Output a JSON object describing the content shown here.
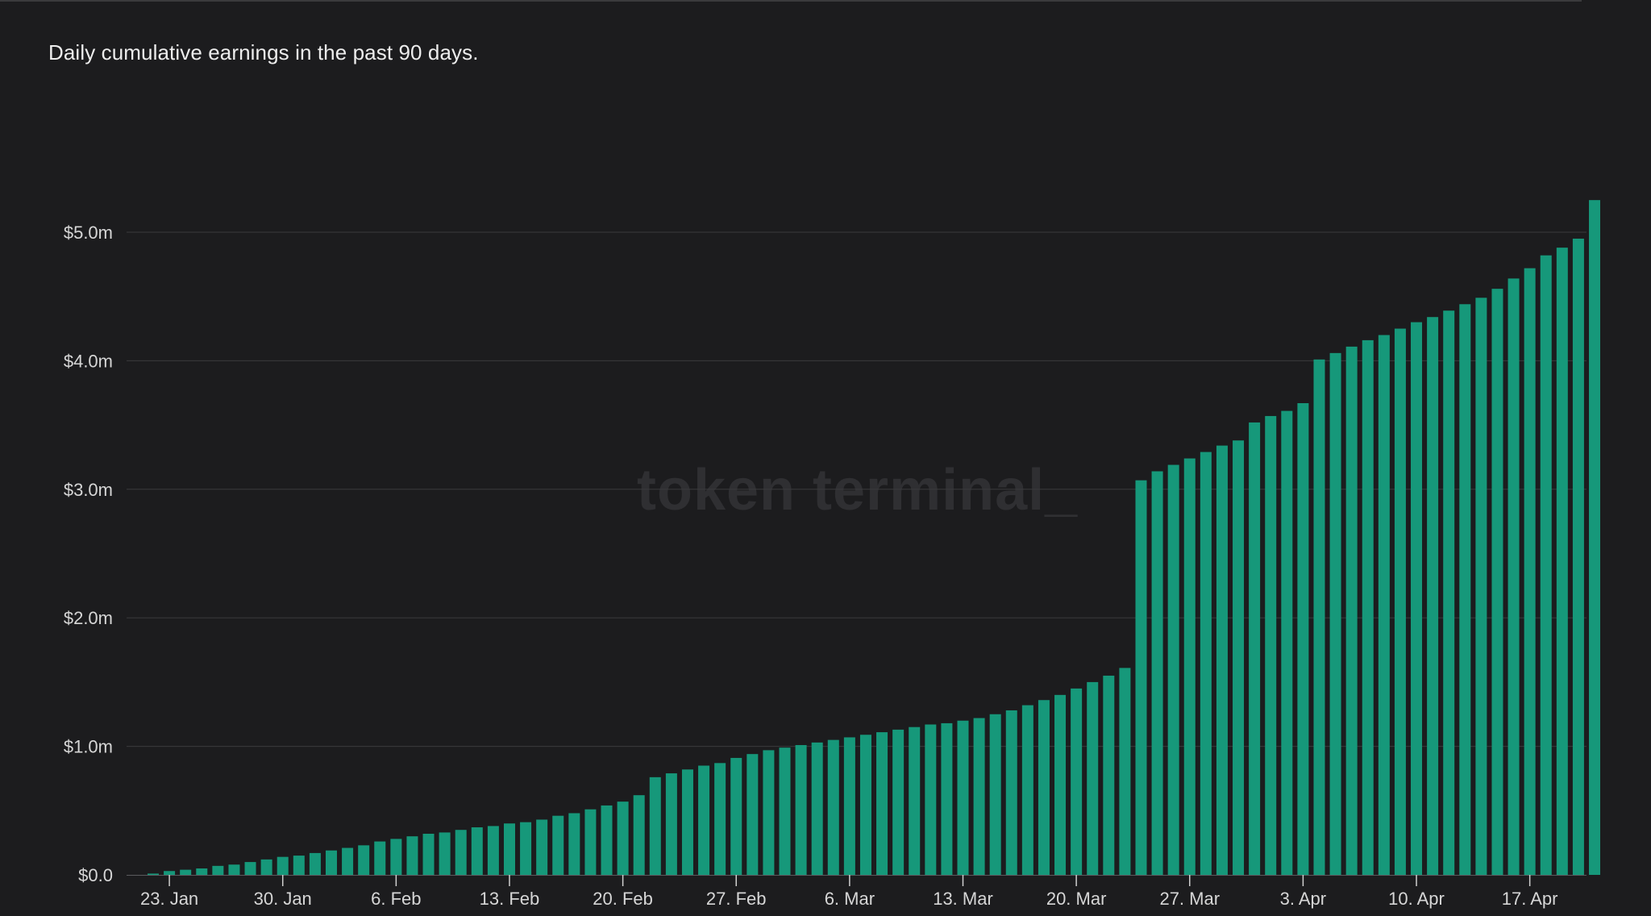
{
  "subtitle": "Daily cumulative earnings in the past 90 days.",
  "watermark": "token terminal_",
  "colors": {
    "bar": "#16987a",
    "background": "#1c1c1e",
    "grid": "#3a3a3c",
    "text": "#d6d6d6"
  },
  "chart_data": {
    "type": "bar",
    "title": "",
    "xlabel": "",
    "ylabel": "",
    "ylim": [
      0,
      5.0
    ],
    "yunit": "$m",
    "grid": true,
    "legend": "none",
    "yticks": [
      "$0.0",
      "$1.0m",
      "$2.0m",
      "$3.0m",
      "$4.0m",
      "$5.0m"
    ],
    "ytick_values": [
      0,
      1,
      2,
      3,
      4,
      5
    ],
    "xticks": [
      "23. Jan",
      "30. Jan",
      "6. Feb",
      "13. Feb",
      "20. Feb",
      "27. Feb",
      "6. Mar",
      "13. Mar",
      "20. Mar",
      "27. Mar",
      "3. Apr",
      "10. Apr",
      "17. Apr"
    ],
    "xtick_dates": [
      "2023-01-23",
      "2023-01-30",
      "2023-02-06",
      "2023-02-13",
      "2023-02-20",
      "2023-02-27",
      "2023-03-06",
      "2023-03-13",
      "2023-03-20",
      "2023-03-27",
      "2023-04-03",
      "2023-04-10",
      "2023-04-17"
    ],
    "x": [
      "2023-01-22",
      "2023-01-23",
      "2023-01-24",
      "2023-01-25",
      "2023-01-26",
      "2023-01-27",
      "2023-01-28",
      "2023-01-29",
      "2023-01-30",
      "2023-01-31",
      "2023-02-01",
      "2023-02-02",
      "2023-02-03",
      "2023-02-04",
      "2023-02-05",
      "2023-02-06",
      "2023-02-07",
      "2023-02-08",
      "2023-02-09",
      "2023-02-10",
      "2023-02-11",
      "2023-02-12",
      "2023-02-13",
      "2023-02-14",
      "2023-02-15",
      "2023-02-16",
      "2023-02-17",
      "2023-02-18",
      "2023-02-19",
      "2023-02-20",
      "2023-02-21",
      "2023-02-22",
      "2023-02-23",
      "2023-02-24",
      "2023-02-25",
      "2023-02-26",
      "2023-02-27",
      "2023-02-28",
      "2023-03-01",
      "2023-03-02",
      "2023-03-03",
      "2023-03-04",
      "2023-03-05",
      "2023-03-06",
      "2023-03-07",
      "2023-03-08",
      "2023-03-09",
      "2023-03-10",
      "2023-03-11",
      "2023-03-12",
      "2023-03-13",
      "2023-03-14",
      "2023-03-15",
      "2023-03-16",
      "2023-03-17",
      "2023-03-18",
      "2023-03-19",
      "2023-03-20",
      "2023-03-21",
      "2023-03-22",
      "2023-03-23",
      "2023-03-24",
      "2023-03-25",
      "2023-03-26",
      "2023-03-27",
      "2023-03-28",
      "2023-03-29",
      "2023-03-30",
      "2023-03-31",
      "2023-04-01",
      "2023-04-02",
      "2023-04-03",
      "2023-04-04",
      "2023-04-05",
      "2023-04-06",
      "2023-04-07",
      "2023-04-08",
      "2023-04-09",
      "2023-04-10",
      "2023-04-11",
      "2023-04-12",
      "2023-04-13",
      "2023-04-14",
      "2023-04-15",
      "2023-04-16",
      "2023-04-17",
      "2023-04-18",
      "2023-04-19",
      "2023-04-20",
      "2023-04-21"
    ],
    "values": [
      0.01,
      0.03,
      0.04,
      0.05,
      0.07,
      0.08,
      0.1,
      0.12,
      0.14,
      0.15,
      0.17,
      0.19,
      0.21,
      0.23,
      0.26,
      0.28,
      0.3,
      0.32,
      0.33,
      0.35,
      0.37,
      0.38,
      0.4,
      0.41,
      0.43,
      0.46,
      0.48,
      0.51,
      0.54,
      0.57,
      0.62,
      0.76,
      0.79,
      0.82,
      0.85,
      0.87,
      0.91,
      0.94,
      0.97,
      0.99,
      1.01,
      1.03,
      1.05,
      1.07,
      1.09,
      1.11,
      1.13,
      1.15,
      1.17,
      1.18,
      1.2,
      1.22,
      1.25,
      1.28,
      1.32,
      1.36,
      1.4,
      1.45,
      1.5,
      1.55,
      1.61,
      3.07,
      3.14,
      3.19,
      3.24,
      3.29,
      3.34,
      3.38,
      3.52,
      3.57,
      3.61,
      3.67,
      4.01,
      4.06,
      4.11,
      4.16,
      4.2,
      4.25,
      4.3,
      4.34,
      4.39,
      4.44,
      4.49,
      4.56,
      4.64,
      4.72,
      4.82,
      4.88,
      4.95,
      5.25
    ]
  }
}
